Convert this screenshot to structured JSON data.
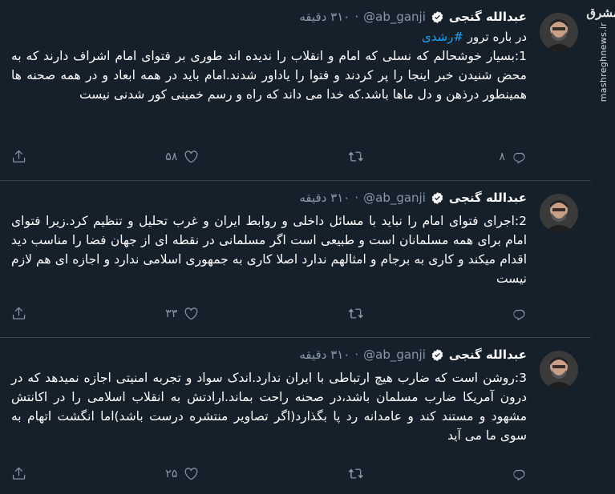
{
  "watermark": {
    "logo": "مشرق",
    "text": "mashreghnews.ir"
  },
  "tweets": [
    {
      "name": "عبدالله گنجی",
      "handle": "@ab_ganji",
      "dot": "·",
      "time": "۳۱۰ دقیقه",
      "subject_prefix": "در باره ترور",
      "hashtag": "#رشدی",
      "text": "1:بسیار خوشحالم که نسلی که امام و انقلاب را ندیده اند طوری بر فتوای امام اشراف دارند که به محض شنیدن خبر اینجا را پر کردند و فتوا را یاداور شدند.امام باید در همه ابعاد و در همه صحنه ها همینطور درذهن و دل ماها باشد.که خدا می داند که راه و رسم خمینی کور شدنی نیست",
      "replies": "۸",
      "retweets": "",
      "likes": "۵۸"
    },
    {
      "name": "عبدالله گنجی",
      "handle": "@ab_ganji",
      "dot": "·",
      "time": "۳۱۰ دقیقه",
      "text": "2:اجرای فتوای امام را نباید با مسائل داخلی و روابط ایران و غرب تحلیل و تنظیم کرد.زیرا فتوای امام برای همه مسلمانان است و طبیعی است اگر مسلمانی در نقطه ای از جهان فضا را مناسب دید اقدام میکند و کاری به برجام و امثالهم ندارد اصلا کاری به جمهوری اسلامی ندارد و اجازه ای هم لازم نیست",
      "replies": "",
      "retweets": "",
      "likes": "۳۳"
    },
    {
      "name": "عبدالله گنجی",
      "handle": "@ab_ganji",
      "dot": "·",
      "time": "۳۱۰ دقیقه",
      "text": "3:روشن است که ضارب هیچ ارتباطی با ایران ندارد.اندک سواد  و تجربه امنیتی اجازه نمیدهد که در درون آمریکا ضارب مسلمان باشد،در صحنه راحت بماند.ارادتش به انقلاب اسلامی را در اکانتش مشهود و مستند کند و عامدانه رد پا بگذارد(اگر تصاویر منتشره درست باشد)اما انگشت اتهام به سوی ما می آید",
      "replies": "",
      "retweets": "",
      "likes": "۲۵"
    }
  ],
  "icons": {
    "reply": "reply-icon",
    "retweet": "retweet-icon",
    "like": "heart-icon",
    "share": "share-icon",
    "verified": "verified-badge-icon"
  },
  "colors": {
    "background": "#15202b",
    "accent": "#1da1f2",
    "muted": "#8899a6",
    "divider": "#38444d"
  }
}
